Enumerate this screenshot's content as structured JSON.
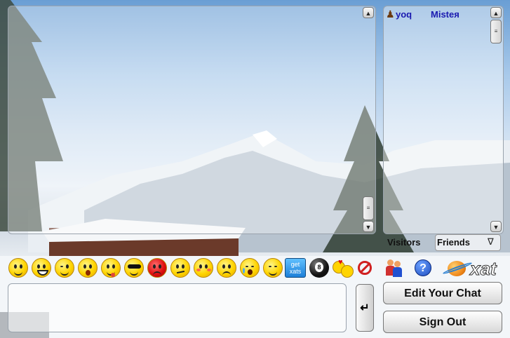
{
  "users": [
    {
      "name": "yoq",
      "icon": "user-icon"
    },
    {
      "name": "Mistея",
      "icon": ""
    }
  ],
  "user_tabs": {
    "visitors": "Visitors",
    "friends": "Friends",
    "friends_arrow": "∇"
  },
  "emoticons": [
    "smile",
    "biggrin",
    "wink",
    "eek",
    "tongue",
    "cool",
    "mad",
    "confused",
    "redface",
    "frown",
    "crying",
    "blush"
  ],
  "get_xats": {
    "line1": "get",
    "line2": "xats"
  },
  "eightball_label": "8",
  "help_label": "?",
  "logo_text": "xat",
  "message_input": {
    "value": "",
    "placeholder": ""
  },
  "return_label": "↵",
  "buttons": {
    "edit_chat": "Edit Your Chat",
    "sign_out": "Sign Out"
  },
  "colors": {
    "username": "#1a1ab0",
    "help_blue": "#1f4fc0",
    "logo_orange": "#f08a1c"
  }
}
